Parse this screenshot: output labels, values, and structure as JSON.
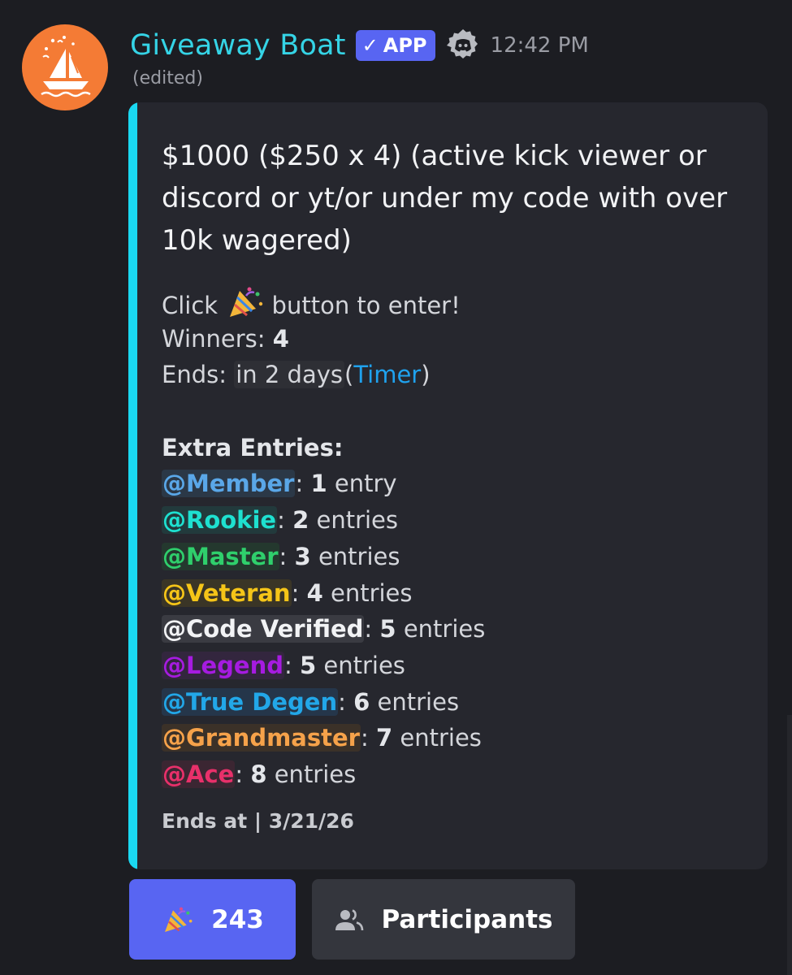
{
  "author": {
    "name": "Giveaway Boat",
    "badge": "APP",
    "time": "12:42 PM",
    "edited": "(edited)",
    "avatar_color": "#f47b35",
    "avatar_icon": "sailboat-party-icon",
    "platform_icon": "discord-icon"
  },
  "embed": {
    "accent_color": "#1ad8f1",
    "title": "$1000 ($250 x 4) (active kick viewer or discord or yt/or under my code with over 10k wagered)",
    "enter_prefix": "Click",
    "enter_suffix": "button to enter!",
    "enter_icon": "party-popper-icon",
    "winners_label": "Winners:",
    "winners": "4",
    "ends_label": "Ends:",
    "ends_value": "in 2 days",
    "ends_open": "(",
    "timer_link": "Timer",
    "ends_close": ")",
    "extra_heading": "Extra Entries:",
    "roles": [
      {
        "mention": "@Member",
        "count": "1",
        "unit": "entry",
        "color": "#5aa7e8",
        "bg": "#2b3847"
      },
      {
        "mention": "@Rookie",
        "count": "2",
        "unit": "entries",
        "color": "#1ee0d0",
        "bg": "#223a3c"
      },
      {
        "mention": "@Master",
        "count": "3",
        "unit": "entries",
        "color": "#2fcf6c",
        "bg": "#24382e"
      },
      {
        "mention": "@Veteran",
        "count": "4",
        "unit": "entries",
        "color": "#f5c518",
        "bg": "#3a3526"
      },
      {
        "mention": "@Code Verified",
        "count": "5",
        "unit": "entries",
        "color": "#f2f3f5",
        "bg": "#3a3b42"
      },
      {
        "mention": "@Legend",
        "count": "5",
        "unit": "entries",
        "color": "#a61be0",
        "bg": "#33263e"
      },
      {
        "mention": "@True Degen",
        "count": "6",
        "unit": "entries",
        "color": "#22a7e8",
        "bg": "#25364a"
      },
      {
        "mention": "@Grandmaster",
        "count": "7",
        "unit": "entries",
        "color": "#f6a24a",
        "bg": "#3b3128"
      },
      {
        "mention": "@Ace",
        "count": "8",
        "unit": "entries",
        "color": "#e8306a",
        "bg": "#3b2632"
      }
    ],
    "footer": "Ends at | 3/21/26"
  },
  "buttons": {
    "enter_count": "243",
    "enter_icon": "party-popper-icon",
    "participants_label": "Participants",
    "participants_icon": "people-icon",
    "enter_color": "#5865f2"
  }
}
